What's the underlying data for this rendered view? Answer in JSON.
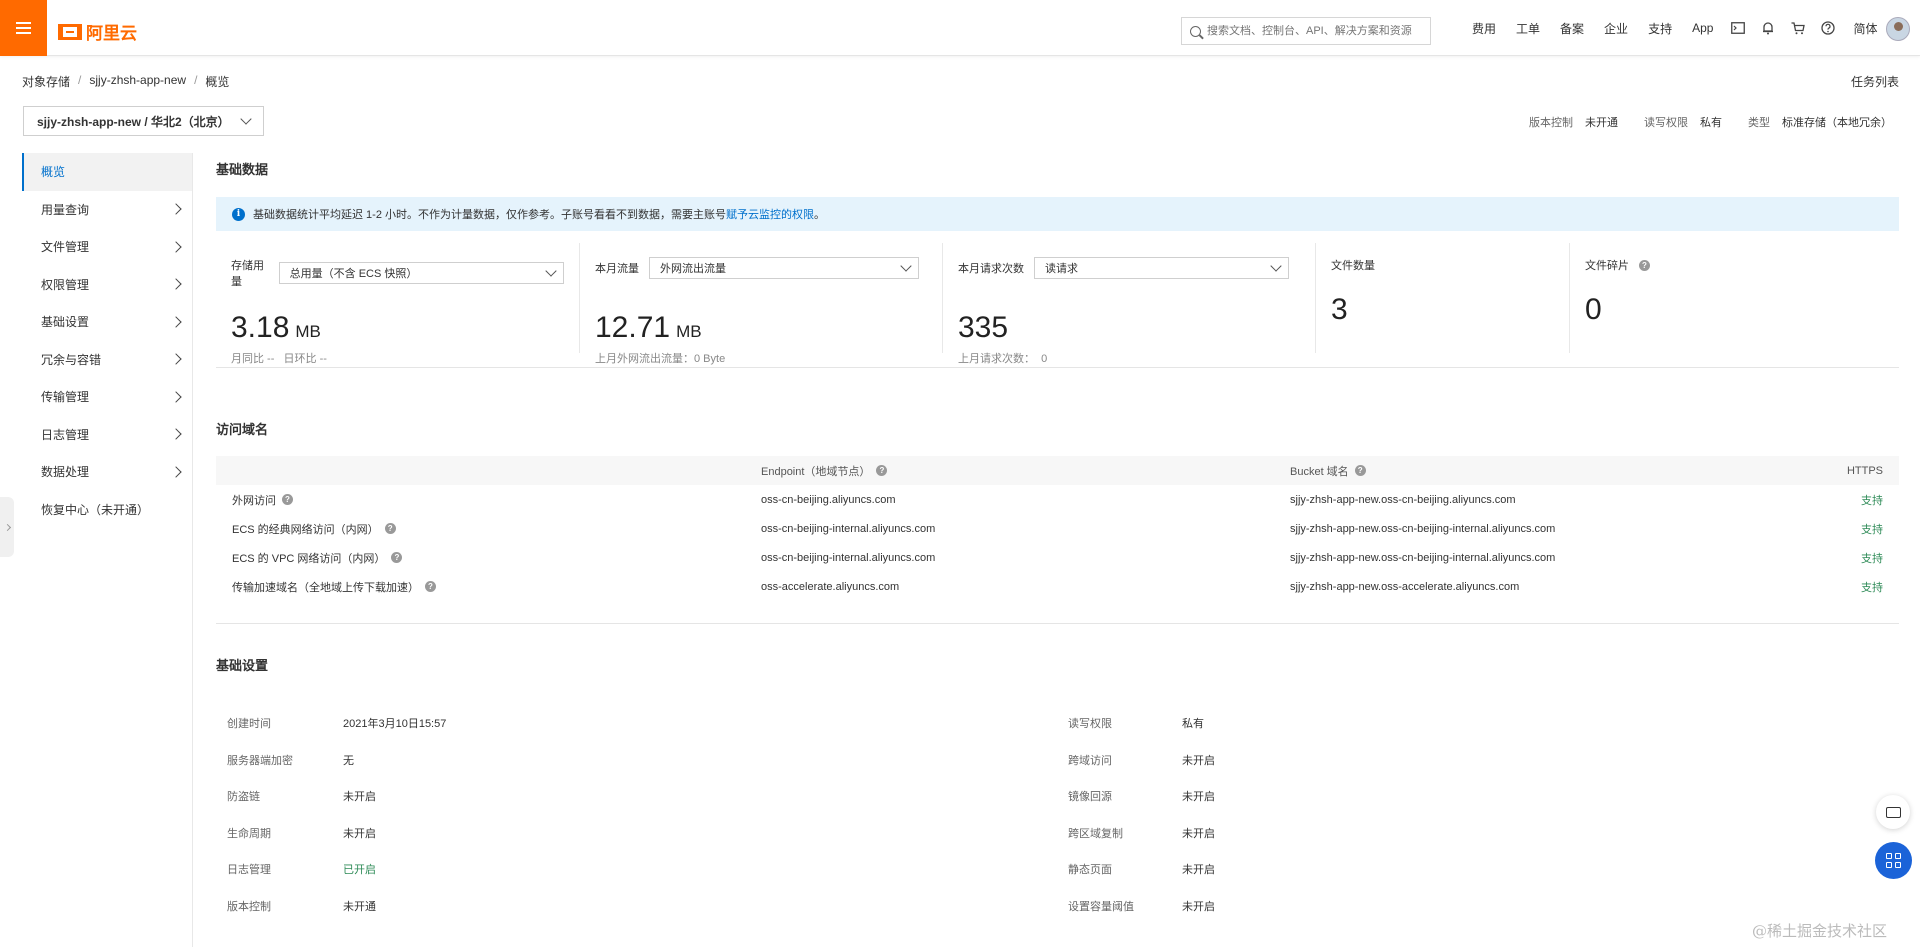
{
  "header": {
    "logo_text": "阿里云",
    "search_placeholder": "搜索文档、控制台、API、解决方案和资源",
    "nav": [
      "费用",
      "工单",
      "备案",
      "企业",
      "支持",
      "App"
    ],
    "lang": "简体",
    "icons": [
      "terminal-icon",
      "bell-icon",
      "cart-icon",
      "help-icon"
    ]
  },
  "breadcrumb": [
    "对象存储",
    "sjjy-zhsh-app-new",
    "概览"
  ],
  "task_list": "任务列表",
  "bucket": {
    "selector_label": "sjjy-zhsh-app-new / 华北2（北京）",
    "meta": [
      {
        "key": "版本控制",
        "value": "未开通"
      },
      {
        "key": "读写权限",
        "value": "私有"
      },
      {
        "key": "类型",
        "value": "标准存储（本地冗余）"
      }
    ]
  },
  "sidebar": {
    "items": [
      {
        "label": "概览",
        "active": true,
        "has_children": false
      },
      {
        "label": "用量查询",
        "has_children": true
      },
      {
        "label": "文件管理",
        "has_children": true
      },
      {
        "label": "权限管理",
        "has_children": true
      },
      {
        "label": "基础设置",
        "has_children": true
      },
      {
        "label": "冗余与容错",
        "has_children": true
      },
      {
        "label": "传输管理",
        "has_children": true
      },
      {
        "label": "日志管理",
        "has_children": true
      },
      {
        "label": "数据处理",
        "has_children": true
      },
      {
        "label": "恢复中心（未开通）",
        "has_children": false
      }
    ]
  },
  "basic_data": {
    "title": "基础数据",
    "notice_text": "基础数据统计平均延迟 1-2 小时。不作为计量数据，仅作参考。子账号看看不到数据，需要主账号",
    "notice_link": "赋予云监控的权限",
    "notice_end": "。",
    "stats": [
      {
        "label": "存储用量",
        "dropdown": "总用量（不含 ECS 快照）",
        "value": "3.18",
        "unit": "MB",
        "sub": "月同比 --   日环比 --"
      },
      {
        "label": "本月流量",
        "dropdown": "外网流出流量",
        "value": "12.71",
        "unit": "MB",
        "sub": "上月外网流出流量：0 Byte"
      },
      {
        "label": "本月请求次数",
        "dropdown": "读请求",
        "value": "335",
        "unit": "",
        "sub": "上月请求次数：  0"
      },
      {
        "label": "文件数量",
        "value": "3"
      },
      {
        "label": "文件碎片",
        "value": "0"
      }
    ]
  },
  "domains": {
    "title": "访问域名",
    "headers": [
      "Endpoint（地域节点）",
      "Bucket 域名",
      "HTTPS"
    ],
    "rows": [
      {
        "name": "外网访问",
        "endpoint": "oss-cn-beijing.aliyuncs.com",
        "bucket_domain": "sjjy-zhsh-app-new.oss-cn-beijing.aliyuncs.com",
        "https": "支持"
      },
      {
        "name": "ECS 的经典网络访问（内网）",
        "endpoint": "oss-cn-beijing-internal.aliyuncs.com",
        "bucket_domain": "sjjy-zhsh-app-new.oss-cn-beijing-internal.aliyuncs.com",
        "https": "支持"
      },
      {
        "name": "ECS 的 VPC 网络访问（内网）",
        "endpoint": "oss-cn-beijing-internal.aliyuncs.com",
        "bucket_domain": "sjjy-zhsh-app-new.oss-cn-beijing-internal.aliyuncs.com",
        "https": "支持"
      },
      {
        "name": "传输加速域名（全地域上传下载加速）",
        "endpoint": "oss-accelerate.aliyuncs.com",
        "bucket_domain": "sjjy-zhsh-app-new.oss-accelerate.aliyuncs.com",
        "https": "支持"
      }
    ]
  },
  "settings": {
    "title": "基础设置",
    "left": [
      {
        "key": "创建时间",
        "value": "2021年3月10日15:57"
      },
      {
        "key": "服务器端加密",
        "value": "无"
      },
      {
        "key": "防盗链",
        "value": "未开启"
      },
      {
        "key": "生命周期",
        "value": "未开启"
      },
      {
        "key": "日志管理",
        "value": "已开启",
        "status": "enabled"
      },
      {
        "key": "版本控制",
        "value": "未开通"
      }
    ],
    "right": [
      {
        "key": "读写权限",
        "value": "私有"
      },
      {
        "key": "跨域访问",
        "value": "未开启"
      },
      {
        "key": "镜像回源",
        "value": "未开启"
      },
      {
        "key": "跨区域复制",
        "value": "未开启"
      },
      {
        "key": "静态页面",
        "value": "未开启"
      },
      {
        "key": "设置容量阈值",
        "value": "未开启"
      }
    ]
  },
  "colors": {
    "brand": "#ff6a00",
    "link": "#0070cc",
    "success": "#2e8b57",
    "notice_bg": "#e5f3fc"
  },
  "watermark": "@稀土掘金技术社区"
}
